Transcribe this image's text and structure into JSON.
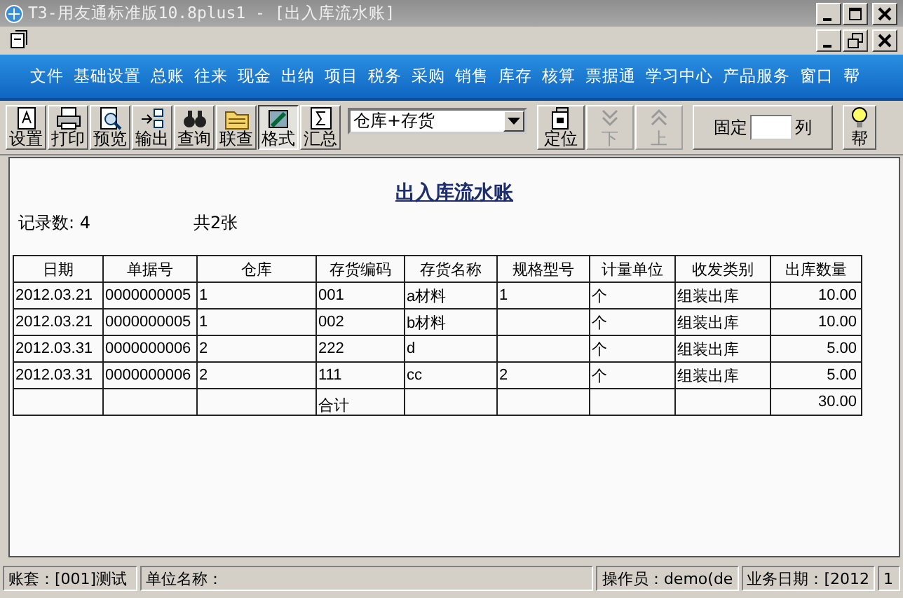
{
  "window": {
    "title": "T3-用友通标准版10.8plus1 - [出入库流水账]"
  },
  "menu": [
    "文件",
    "基础设置",
    "总账",
    "往来",
    "现金",
    "出纳",
    "项目",
    "税务",
    "采购",
    "销售",
    "库存",
    "核算",
    "票据通",
    "学习中心",
    "产品服务",
    "窗口",
    "帮"
  ],
  "toolbar": {
    "buttons_left": [
      {
        "label": "设置",
        "disabled": false,
        "pressed": false
      },
      {
        "label": "打印",
        "disabled": false,
        "pressed": false
      },
      {
        "label": "预览",
        "disabled": false,
        "pressed": false
      },
      {
        "label": "输出",
        "disabled": false,
        "pressed": false
      },
      {
        "label": "查询",
        "disabled": false,
        "pressed": false
      },
      {
        "label": "联查",
        "disabled": false,
        "pressed": false
      },
      {
        "label": "格式",
        "disabled": false,
        "pressed": true
      },
      {
        "label": "汇总",
        "disabled": false,
        "pressed": false
      }
    ],
    "dropdown": {
      "value": "仓库+存货"
    },
    "buttons_right": [
      {
        "label": "定位",
        "disabled": false,
        "pressed": false
      },
      {
        "label": "下",
        "disabled": true,
        "pressed": false
      },
      {
        "label": "上",
        "disabled": true,
        "pressed": false
      }
    ],
    "fixed_label": "固定",
    "fixed_unit": "列",
    "help": "帮"
  },
  "report": {
    "title": "出入库流水账",
    "record_count": "记录数: 4",
    "pages": "共2张",
    "columns": [
      "日期",
      "单据号",
      "仓库",
      "存货编码",
      "存货名称",
      "规格型号",
      "计量单位",
      "收发类别",
      "出库数量"
    ],
    "rows": [
      [
        "2012.03.21",
        "0000000005",
        "1",
        "001",
        "a材料",
        "1",
        "个",
        "组装出库",
        "10.00"
      ],
      [
        "2012.03.21",
        "0000000005",
        "1",
        "002",
        "b材料",
        "",
        "个",
        "组装出库",
        "10.00"
      ],
      [
        "2012.03.31",
        "0000000006",
        "2",
        "222",
        "d",
        "",
        "个",
        "组装出库",
        "5.00"
      ],
      [
        "2012.03.31",
        "0000000006",
        "2",
        "111",
        "cc",
        "2",
        "个",
        "组装出库",
        "5.00"
      ]
    ],
    "total_label": "合计",
    "total": "30.00"
  },
  "status_bar": [
    "账套：[001]测试",
    "单位名称：",
    "操作员：demo(de",
    "业务日期：[2012",
    "1"
  ]
}
